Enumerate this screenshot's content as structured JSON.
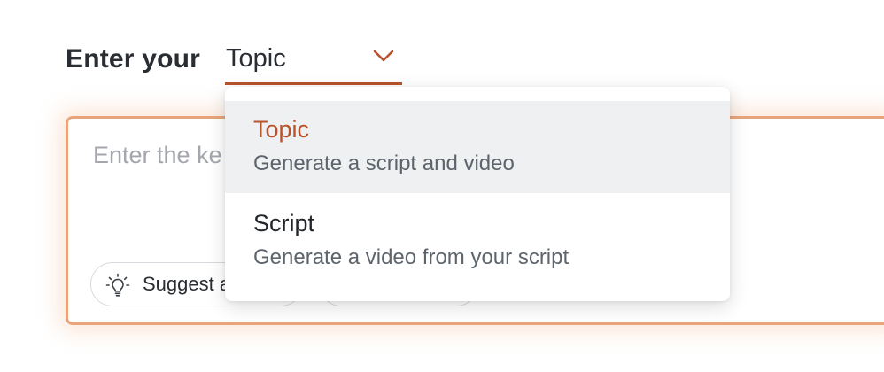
{
  "prompt": {
    "label": "Enter your"
  },
  "mode_select": {
    "selected_value": "Topic",
    "accent_color": "#b8532c"
  },
  "input": {
    "placeholder_visible": "Enter the ke"
  },
  "chips": {
    "suggest_label_visible": "Suggest a",
    "suggest_icon": "lightbulb-icon"
  },
  "dropdown": {
    "options": [
      {
        "title": "Topic",
        "description": "Generate a script and video",
        "selected": true
      },
      {
        "title": "Script",
        "description": "Generate a video from your script",
        "selected": false
      }
    ]
  },
  "colors": {
    "accent": "#b8532c",
    "card_border": "#e8a57c",
    "option_hover_bg": "#eef0f2"
  }
}
